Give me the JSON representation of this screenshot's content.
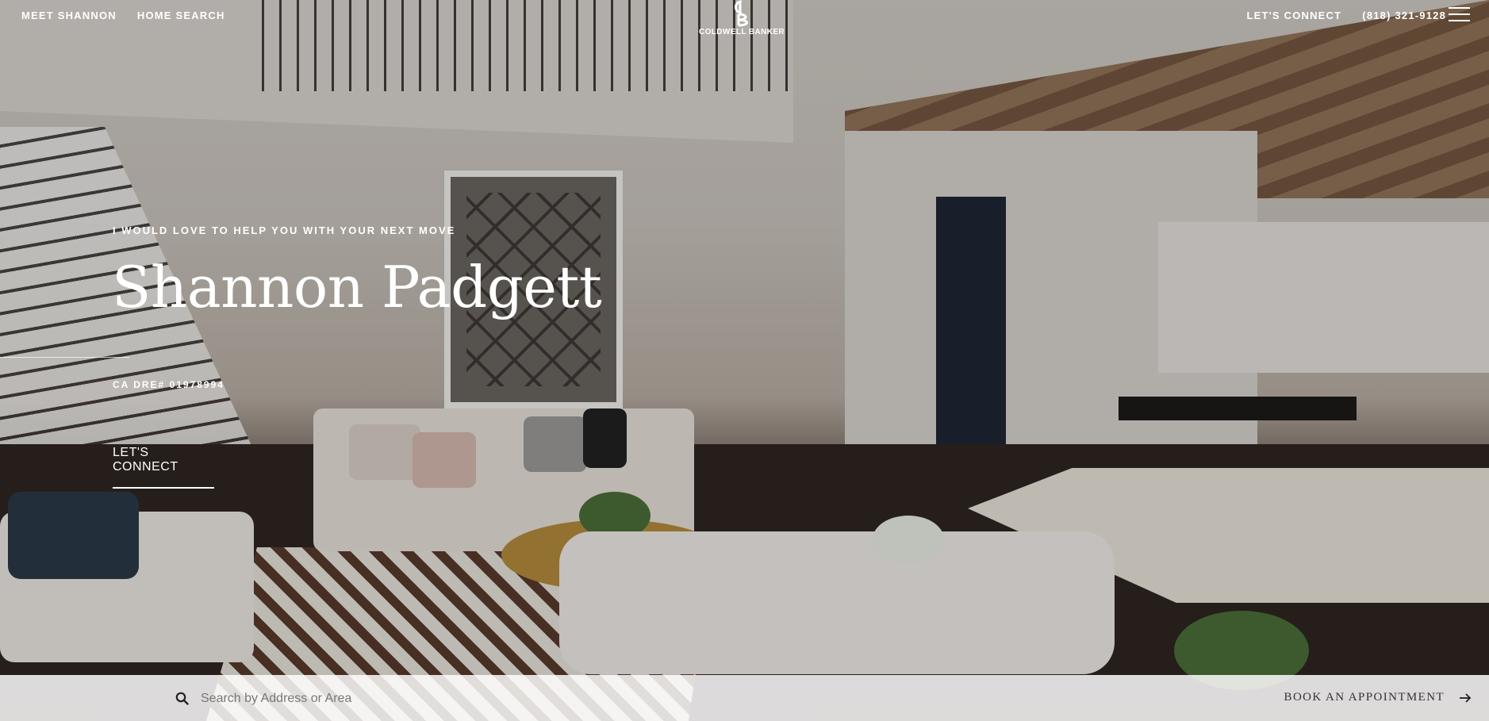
{
  "nav": {
    "left_items": [
      "MEET SHANNON",
      "HOME SEARCH"
    ],
    "logo_text": "COLDWELL BANKER",
    "connect": "LET'S CONNECT",
    "phone": "(818) 321-9128"
  },
  "hero": {
    "eyebrow": "I WOULD LOVE TO HELP YOU WITH YOUR NEXT MOVE",
    "name": "Shannon Padgett",
    "license": "CA DRE# 01978994",
    "cta": "LET'S CONNECT"
  },
  "bottom": {
    "search_placeholder": "Search by Address or Area",
    "book": "BOOK AN APPOINTMENT"
  },
  "icons": {
    "search": "search-icon",
    "arrow": "arrow-right-icon",
    "menu": "hamburger-menu-icon",
    "logo": "coldwell-banker-logo"
  }
}
